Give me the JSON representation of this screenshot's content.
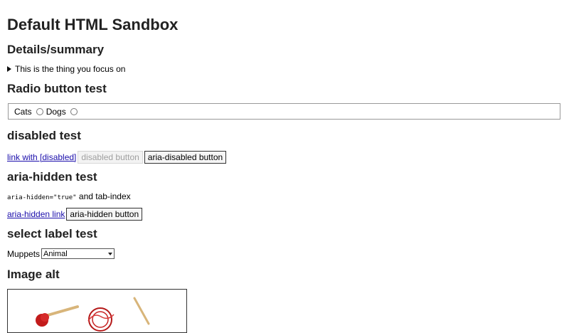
{
  "title": "Default HTML Sandbox",
  "details": {
    "heading": "Details/summary",
    "summary": "This is the thing you focus on"
  },
  "radio": {
    "heading": "Radio button test",
    "options": [
      "Cats",
      "Dogs"
    ]
  },
  "disabled": {
    "heading": "disabled test",
    "link": "link with [disabled]",
    "disabled_button": "disabled button",
    "aria_disabled_button": "aria-disabled button"
  },
  "aria_hidden": {
    "heading": "aria-hidden test",
    "code": "aria-hidden=\"true\"",
    "tail": "and tab-index",
    "link": "aria-hidden link",
    "button": "aria-hidden button"
  },
  "select": {
    "heading": "select label test",
    "label": "Muppets",
    "selected": "Animal"
  },
  "image": {
    "heading": "Image alt"
  }
}
